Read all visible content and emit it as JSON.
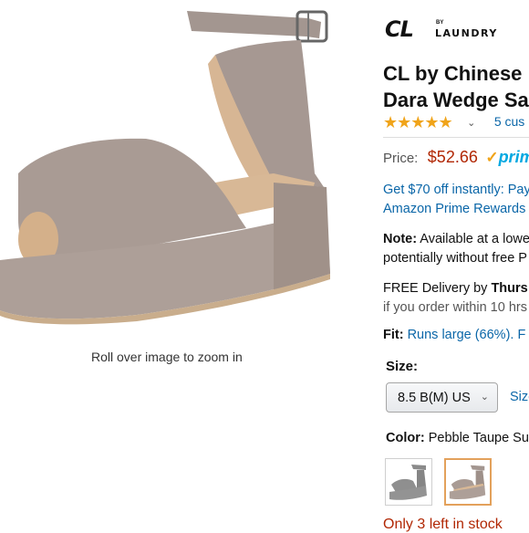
{
  "gallery": {
    "zoom_hint": "Roll over image to zoom in"
  },
  "brand": {
    "logo_big": "CL",
    "logo_by": "BY",
    "logo_laundry": "LAUNDRY"
  },
  "product": {
    "title_line1": "CL by Chinese",
    "title_line2": "Dara Wedge Sa",
    "rating_stars": 4.5,
    "stars_glyphs": "★★★★★",
    "reviews_text": "5 cus"
  },
  "price": {
    "label": "Price:",
    "value": "$52.66",
    "prime_check": "✓",
    "prime_text": "prime"
  },
  "offer": {
    "line1": "Get $70 off instantly: Pay",
    "line2": "Amazon Prime Rewards"
  },
  "note": {
    "label": "Note:",
    "line1_rest": " Available at a lowe",
    "line2": "potentially without free P"
  },
  "delivery": {
    "line1_prefix": "FREE Delivery by ",
    "line1_day": "Thurs",
    "line2": "if you order within 10 hrs"
  },
  "fit": {
    "label": "Fit:",
    "value": "Runs large (66%). F"
  },
  "size": {
    "label": "Size:",
    "selected": "8.5 B(M) US",
    "chart_link": "Size"
  },
  "color": {
    "label": "Color:",
    "value": "Pebble Taupe Su",
    "swatches": [
      "gray",
      "pebble-taupe"
    ]
  },
  "stock": {
    "text": "Only 3 left in stock"
  }
}
